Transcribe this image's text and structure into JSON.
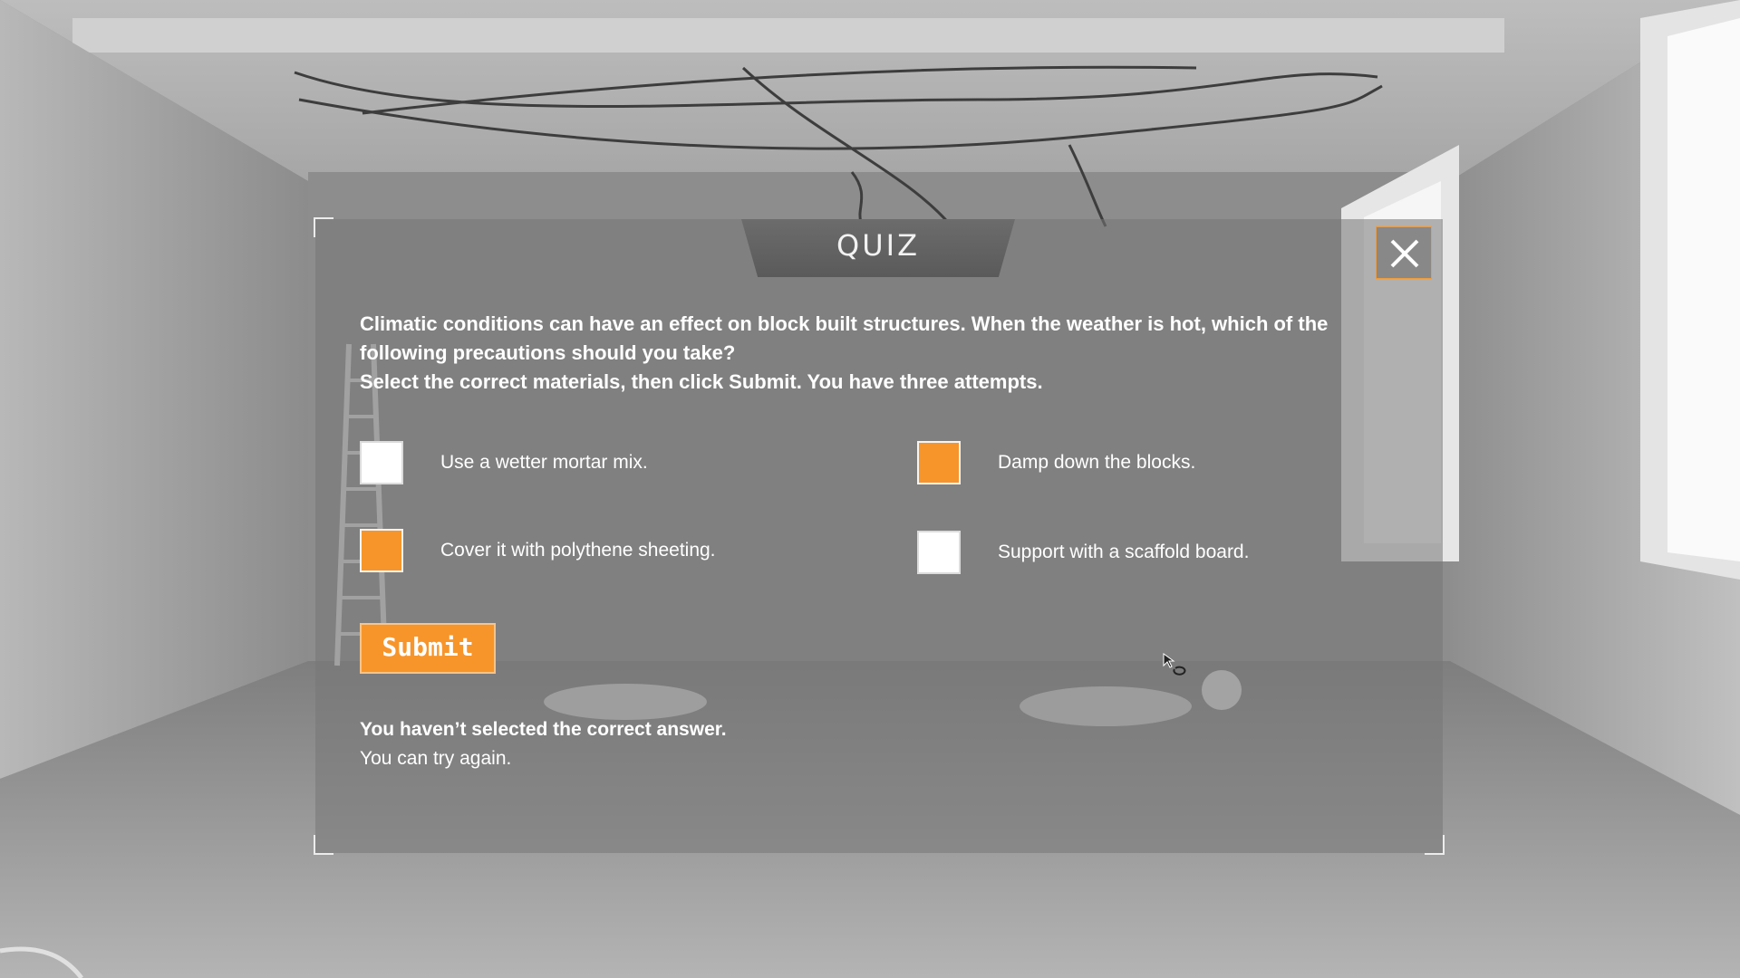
{
  "quiz": {
    "title": "QUIZ",
    "question_lines": [
      "Climatic conditions can have an effect on block built structures. When the weather is hot, which of the following precautions should you take?",
      "Select the correct materials, then click Submit. You have three attempts."
    ],
    "options": [
      {
        "label": "Use a wetter mortar mix.",
        "checked": false
      },
      {
        "label": "Damp down the blocks.",
        "checked": true
      },
      {
        "label": "Cover it with polythene sheeting.",
        "checked": true
      },
      {
        "label": "Support with a scaffold board.",
        "checked": false
      }
    ],
    "submit_label": "Submit",
    "feedback_title": "You haven’t selected the correct answer.",
    "feedback_text": "You can try again."
  },
  "icons": {
    "close": "close-icon",
    "checkbox": "checkbox-square"
  },
  "colors": {
    "accent": "#f7952a",
    "panel": "#767676",
    "text": "#ffffff"
  }
}
